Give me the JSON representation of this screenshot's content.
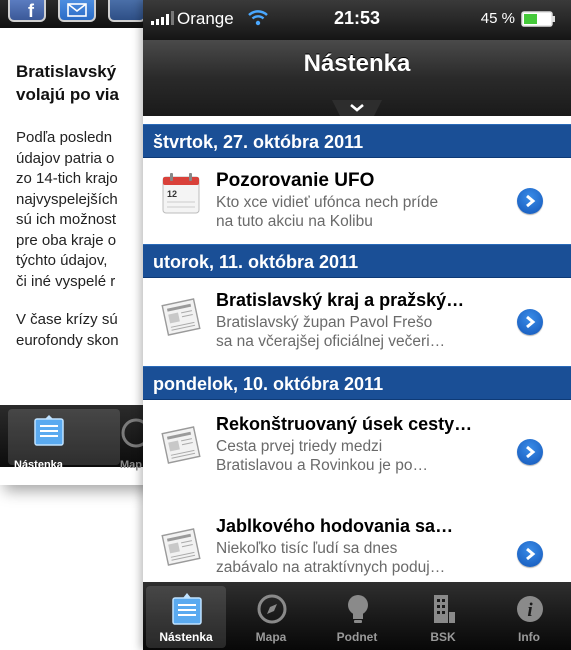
{
  "background_app": {
    "share_icons": [
      "facebook-icon",
      "mail-icon",
      "share-icon"
    ],
    "article_title_lines": [
      "Bratislavský",
      "volajú po via"
    ],
    "paragraph1_lines": [
      "Podľa posledn",
      "údajov patria o",
      "zo 14-tich krajo",
      "najvyspelejších",
      "sú ich možnost",
      "pre oba kraje o",
      "týchto údajov,",
      "či iné vyspelé r"
    ],
    "paragraph2_lines": [
      "V čase krízy sú",
      "eurofondy skon"
    ],
    "tabbar": {
      "active_label": "Nástenka",
      "second_label": "Map"
    }
  },
  "statusbar": {
    "carrier": "Orange",
    "time": "21:53",
    "battery": "45 %"
  },
  "navbar": {
    "title": "Nástenka"
  },
  "sections": [
    {
      "date": "štvrtok, 27. októbra 2011",
      "items": [
        {
          "icon": "calendar-icon",
          "title": "Pozorovanie UFO",
          "desc_lines": [
            "Kto xce vidieť ufónca nech príde",
            "na tuto akciu na Kolibu"
          ]
        }
      ]
    },
    {
      "date": "utorok, 11. októbra 2011",
      "items": [
        {
          "icon": "newspaper-icon",
          "title": "Bratislavský kraj a pražský…",
          "desc_lines": [
            "Bratislavský župan Pavol Frešo",
            "sa na včerajšej oficiálnej večeri…"
          ]
        }
      ]
    },
    {
      "date": "pondelok, 10. októbra 2011",
      "items": [
        {
          "icon": "newspaper-icon",
          "title": "Rekonštruovaný úsek cesty…",
          "desc_lines": [
            "Cesta prvej triedy medzi",
            "Bratislavou a Rovinkou je po…"
          ]
        },
        {
          "icon": "newspaper-icon",
          "title": "Jablkového hodovania sa…",
          "desc_lines": [
            "Niekoľko tisíc ľudí sa dnes",
            "zabávalo na atraktívnych poduj…"
          ]
        }
      ]
    }
  ],
  "tabbar": {
    "tabs": [
      {
        "label": "Nástenka",
        "icon": "board-icon",
        "active": true
      },
      {
        "label": "Mapa",
        "icon": "compass-icon",
        "active": false
      },
      {
        "label": "Podnet",
        "icon": "lightbulb-icon",
        "active": false
      },
      {
        "label": "BSK",
        "icon": "building-icon",
        "active": false
      },
      {
        "label": "Info",
        "icon": "info-icon",
        "active": false
      }
    ]
  },
  "colors": {
    "section_header": "#1a4f96",
    "disclosure": "#1e6fd9",
    "bar_dark": "#1a1a1a"
  }
}
